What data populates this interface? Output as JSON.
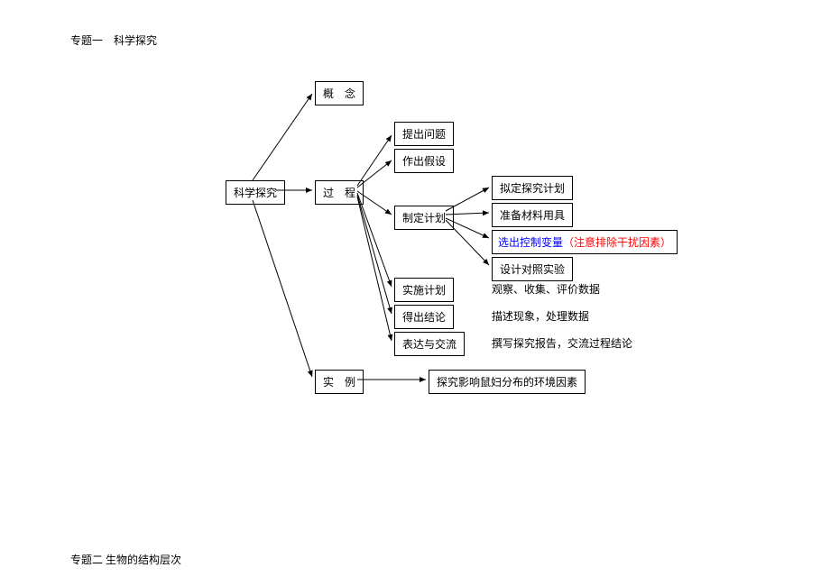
{
  "heading1": "专题一　科学探究",
  "heading2": "专题二  生物的结构层次",
  "root": "科学探究",
  "branches": {
    "concept": "概　念",
    "process": "过　程",
    "example": "实　例"
  },
  "process_children": {
    "raise_question": "提出问题",
    "make_hypothesis": "作出假设",
    "make_plan": "制定计划",
    "implement_plan": "实施计划",
    "draw_conclusion": "得出结论",
    "express_communicate": "表达与交流"
  },
  "plan_children": {
    "draft_plan": "拟定探究计划",
    "prepare_materials": "准备材料用具",
    "select_control_var": "选出控制变量",
    "select_control_note": "（注意排除干扰因素）",
    "design_control": "设计对照实验"
  },
  "implement_note": "观察、收集、评价数据",
  "conclusion_note": "描述现象，处理数据",
  "express_note": "撰写探究报告，交流过程结论",
  "example_content": "探究影响鼠妇分布的环境因素",
  "chart_data": {
    "type": "tree",
    "root": "科学探究",
    "children": [
      {
        "label": "概念"
      },
      {
        "label": "过程",
        "children": [
          {
            "label": "提出问题"
          },
          {
            "label": "作出假设"
          },
          {
            "label": "制定计划",
            "children": [
              {
                "label": "拟定探究计划"
              },
              {
                "label": "准备材料用具"
              },
              {
                "label": "选出控制变量（注意排除干扰因素）"
              },
              {
                "label": "设计对照实验"
              }
            ]
          },
          {
            "label": "实施计划",
            "note": "观察、收集、评价数据"
          },
          {
            "label": "得出结论",
            "note": "描述现象，处理数据"
          },
          {
            "label": "表达与交流",
            "note": "撰写探究报告，交流过程结论"
          }
        ]
      },
      {
        "label": "实例",
        "children": [
          {
            "label": "探究影响鼠妇分布的环境因素"
          }
        ]
      }
    ]
  }
}
